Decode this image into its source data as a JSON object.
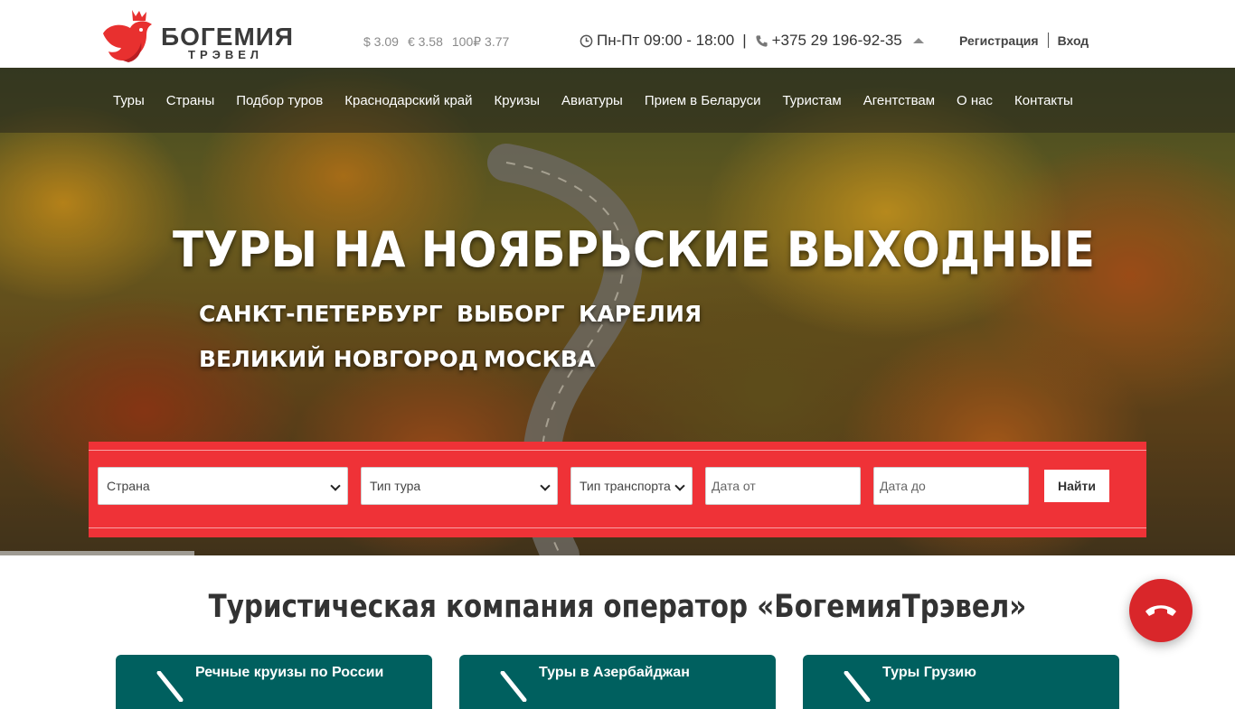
{
  "brand": {
    "name": "БОГЕМИЯ",
    "subtitle": "ТРЭВЕЛ",
    "accent_color": "#ef3237"
  },
  "rates": [
    {
      "label": "$ 3.09"
    },
    {
      "label": "€ 3.58"
    },
    {
      "label": "100₽ 3.77"
    }
  ],
  "contact": {
    "hours": "Пн-Пт 09:00 - 18:00",
    "separator": "|",
    "phone": "+375 29 196-92-35"
  },
  "auth": {
    "register": "Регистрация",
    "login": "Вход"
  },
  "nav": [
    {
      "label": "Туры"
    },
    {
      "label": "Страны"
    },
    {
      "label": "Подбор туров"
    },
    {
      "label": "Краснодарский край"
    },
    {
      "label": "Круизы"
    },
    {
      "label": "Авиатуры"
    },
    {
      "label": "Прием в Беларуси"
    },
    {
      "label": "Туристам"
    },
    {
      "label": "Агентствам"
    },
    {
      "label": "О нас"
    },
    {
      "label": "Контакты"
    }
  ],
  "hero": {
    "title": "ТУРЫ НА НОЯБРЬСКИЕ ВЫХОДНЫЕ",
    "destinations": [
      "САНКТ-ПЕТЕРБУРГ",
      "ВЫБОРГ",
      "КАРЕЛИЯ",
      "ВЕЛИКИЙ НОВГОРОД",
      "МОСКВА"
    ]
  },
  "search": {
    "country": "Страна",
    "tour_type": "Тип тура",
    "transport": "Тип транспорта",
    "date_from": "Дата от",
    "date_to": "Дата до",
    "submit": "Найти"
  },
  "section": {
    "title": "Туристическая компания оператор «БогемияТрэвел»"
  },
  "cards": [
    {
      "label": "Речные круизы по России"
    },
    {
      "label": "Туры в Азербайджан"
    },
    {
      "label": "Туры Грузию"
    }
  ],
  "colors": {
    "card_bg": "#00605f",
    "call_button": "#d9262a"
  },
  "icons": {
    "hours": "clock-icon",
    "phone": "phone-icon",
    "call": "phone-hangup-icon"
  }
}
